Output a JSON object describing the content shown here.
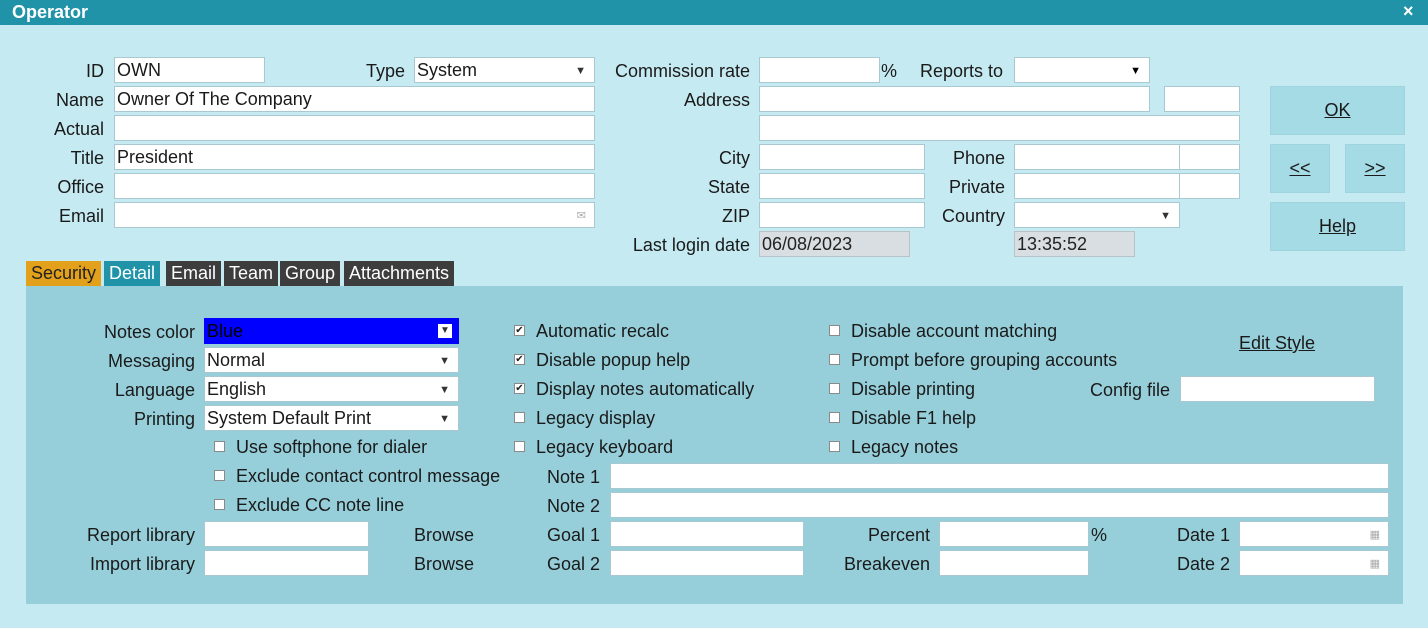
{
  "window": {
    "title": "Operator",
    "close": "×"
  },
  "header": {
    "id_label": "ID",
    "id_value": "OWN",
    "type_label": "Type",
    "type_value": "System",
    "name_label": "Name",
    "name_value": "Owner Of The Company",
    "actual_label": "Actual",
    "actual_value": "",
    "title_label": "Title",
    "title_value": "President",
    "office_label": "Office",
    "office_value": "",
    "email_label": "Email",
    "email_value": "",
    "commission_label": "Commission rate",
    "commission_value": "",
    "percent_sign": "%",
    "reports_label": "Reports to",
    "reports_value": "",
    "address_label": "Address",
    "city_label": "City",
    "state_label": "State",
    "zip_label": "ZIP",
    "phone_label": "Phone",
    "private_label": "Private",
    "country_label": "Country",
    "last_login_label": "Last login date",
    "last_login_date": "06/08/2023",
    "last_login_time": "13:35:52"
  },
  "buttons": {
    "ok": "OK",
    "prev": "<<",
    "next": ">>",
    "help": "Help"
  },
  "tabs": [
    "Security",
    "Detail",
    "Email",
    "Team",
    "Group",
    "Attachments"
  ],
  "detail": {
    "notes_color_label": "Notes color",
    "notes_color_value": "Blue",
    "messaging_label": "Messaging",
    "messaging_value": "Normal",
    "language_label": "Language",
    "language_value": "English",
    "printing_label": "Printing",
    "printing_value": "System Default Print",
    "col1_checks": [
      {
        "label": "Use softphone for dialer",
        "checked": false
      },
      {
        "label": "Exclude contact control message",
        "checked": false
      },
      {
        "label": "Exclude CC note line",
        "checked": false
      }
    ],
    "col2_checks": [
      {
        "label": "Automatic recalc",
        "checked": true
      },
      {
        "label": "Disable popup help",
        "checked": true
      },
      {
        "label": "Display notes automatically",
        "checked": true
      },
      {
        "label": "Legacy display",
        "checked": false
      },
      {
        "label": "Legacy keyboard",
        "checked": false
      }
    ],
    "col3_checks": [
      {
        "label": "Disable account matching",
        "checked": false
      },
      {
        "label": "Prompt before grouping accounts",
        "checked": false
      },
      {
        "label": "Disable printing",
        "checked": false
      },
      {
        "label": "Disable F1 help",
        "checked": false
      },
      {
        "label": "Legacy notes",
        "checked": false
      }
    ],
    "edit_style": "Edit Style",
    "config_file_label": "Config file",
    "config_file_value": "",
    "note1_label": "Note 1",
    "note2_label": "Note 2",
    "report_library_label": "Report library",
    "import_library_label": "Import library",
    "browse1": "Browse",
    "browse2": "Browse",
    "goal1_label": "Goal 1",
    "goal2_label": "Goal 2",
    "percent_label": "Percent",
    "percent_sign": "%",
    "breakeven_label": "Breakeven",
    "date1_label": "Date 1",
    "date2_label": "Date 2"
  },
  "colors": {
    "notes_color": "#0000ff"
  }
}
